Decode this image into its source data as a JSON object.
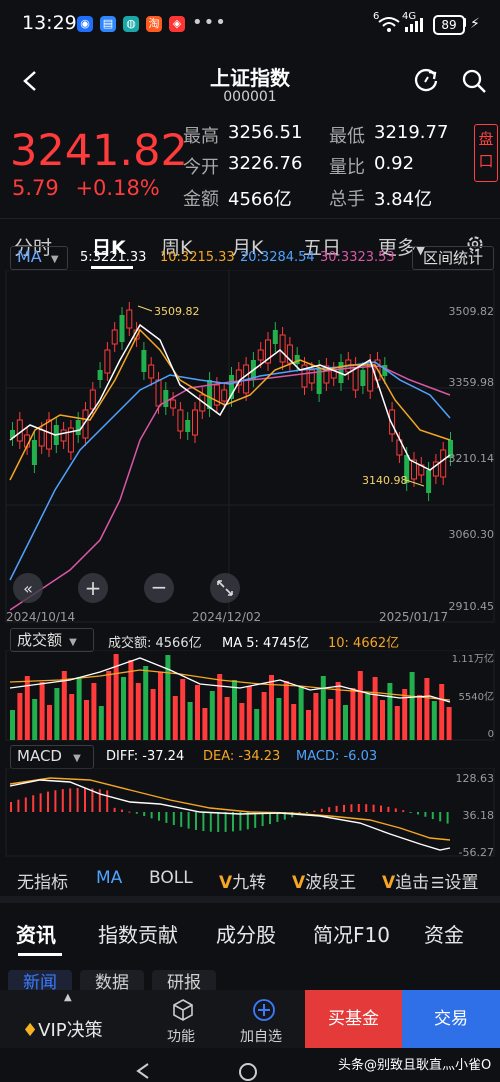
{
  "status": {
    "time": "13:29",
    "battery": "89",
    "signal": "4G",
    "wifi": "6"
  },
  "header": {
    "title": "上证指数",
    "code": "000001"
  },
  "quote": {
    "price": "3241.82",
    "change": "5.79",
    "change_pct": "+0.18%",
    "high_label": "最高",
    "high": "3256.51",
    "low_label": "最低",
    "low": "3219.77",
    "open_label": "今开",
    "open": "3226.76",
    "ratio_label": "量比",
    "ratio": "0.92",
    "amount_label": "金额",
    "amount": "4566亿",
    "turnover_label": "总手",
    "turnover": "3.84亿",
    "pan_button": "盘口"
  },
  "periods": {
    "tabs": [
      "分时",
      "日K",
      "周K",
      "月K",
      "五日",
      "更多"
    ],
    "active": "日K"
  },
  "ma_bar": {
    "selector": "MA",
    "ma5": "5:3221.33",
    "ma10": "10:3215.33",
    "ma20": "20:3284.54",
    "ma30": "30:3323.53",
    "range_button": "区间统计"
  },
  "kline": {
    "y_ticks": [
      "3509.82",
      "3359.98",
      "3210.14",
      "3060.30",
      "2910.45"
    ],
    "x_dates": [
      "2024/10/14",
      "2024/12/02",
      "2025/01/17"
    ],
    "high_note": "3509.82",
    "low_note": "3140.98"
  },
  "volume": {
    "selector": "成交额",
    "amount": "成交额: 4566亿",
    "ma5": "MA 5: 4745亿",
    "ma10": "10: 4662亿",
    "ticks": [
      "1.11万亿",
      "5540亿",
      "0"
    ]
  },
  "macd": {
    "selector": "MACD",
    "diff": "DIFF: -37.24",
    "dea": "DEA: -34.23",
    "macd": "MACD: -6.03",
    "ticks": [
      "128.63",
      "36.18",
      "-56.27"
    ]
  },
  "indicators": [
    "无指标",
    "MA",
    "BOLL",
    "九转",
    "波段王",
    "追击"
  ],
  "indicator_settings": "设置",
  "news_tabs": [
    "资讯",
    "指数贡献",
    "成分股",
    "简况F10",
    "资金"
  ],
  "sub_tabs": [
    "新闻",
    "数据",
    "研报"
  ],
  "bottom": {
    "vip": "VIP决策",
    "func": "功能",
    "add": "加自选",
    "buy_fund": "买基金",
    "trade": "交易"
  },
  "watermark": "头条@别致且耿直灬小雀O",
  "colors": {
    "up": "#ff3b3b",
    "down": "#22b04e",
    "accent": "#3a7bff",
    "ma5": "#ffffff",
    "ma10": "#f5a623",
    "ma20": "#4ea3ff",
    "ma30": "#d958a6"
  }
}
